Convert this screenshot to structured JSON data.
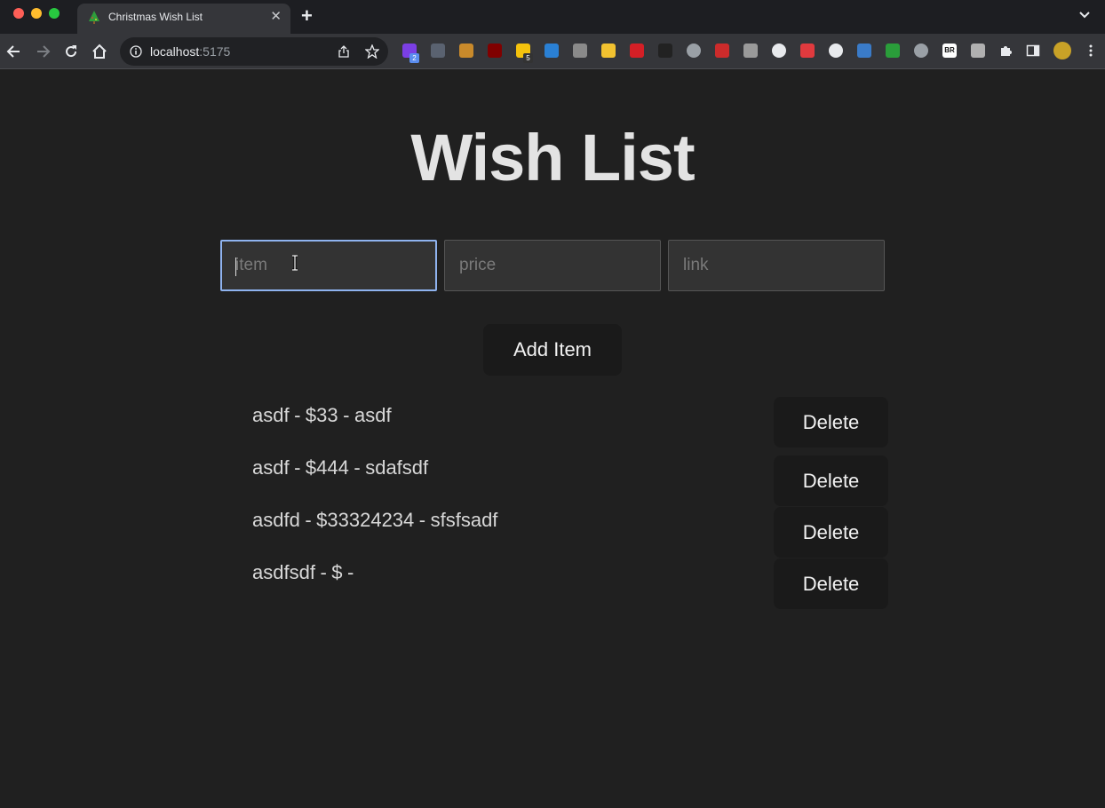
{
  "browser": {
    "tab_title": "Christmas Wish List",
    "tab_close": "✕",
    "new_tab": "+",
    "url_host": "localhost",
    "url_port": ":5175",
    "extensions": [
      {
        "icon": "ext-b-icon",
        "color": "#7b3fe4",
        "badge": "2"
      },
      {
        "icon": "ext-css-icon",
        "color": "#5a6270"
      },
      {
        "icon": "ext-box-icon",
        "color": "#c98a2b"
      },
      {
        "icon": "ublock-icon",
        "color": "#800000"
      },
      {
        "icon": "ext-note-icon",
        "color": "#f4c20d",
        "badge": "5"
      },
      {
        "icon": "ext-diamond-icon",
        "color": "#2a80d4"
      },
      {
        "icon": "ext-h-icon",
        "color": "#8a8a8a"
      },
      {
        "icon": "ext-circle-icon",
        "color": "#f2c230"
      },
      {
        "icon": "ext-red-icon",
        "color": "#d41f26"
      },
      {
        "icon": "ext-glasses-icon",
        "color": "#222222"
      },
      {
        "icon": "ext-check-icon",
        "color": "#9aa0a6"
      },
      {
        "icon": "ext-yt-icon",
        "color": "#cc2b2b"
      },
      {
        "icon": "ext-window-icon",
        "color": "#9a9a9a"
      },
      {
        "icon": "ext-move-icon",
        "color": "#e8eaed"
      },
      {
        "icon": "ext-dice-icon",
        "color": "#e03a3e"
      },
      {
        "icon": "ext-clock-icon",
        "color": "#e8eaed"
      },
      {
        "icon": "ext-grid-icon",
        "color": "#3a7bc8"
      },
      {
        "icon": "ext-shield-icon",
        "color": "#2a9d3a"
      },
      {
        "icon": "ext-down-icon",
        "color": "#9aa0a6"
      },
      {
        "icon": "ext-br-icon",
        "color": "#ffffff",
        "text": "BR"
      },
      {
        "icon": "ext-s-icon",
        "color": "#b0b0b0"
      },
      {
        "icon": "extensions-puzzle-icon",
        "color": "#e8eaed"
      },
      {
        "icon": "side-panel-icon",
        "color": "#e8eaed"
      },
      {
        "icon": "profile-avatar-icon",
        "color": "#c9a227"
      },
      {
        "icon": "menu-kebab-icon",
        "color": "#e8eaed"
      }
    ]
  },
  "app": {
    "title": "Wish List",
    "inputs": {
      "item_placeholder": "item",
      "price_placeholder": "price",
      "link_placeholder": "link"
    },
    "add_button": "Add Item",
    "delete_label": "Delete",
    "items": [
      {
        "name": "asdf",
        "price": "$33",
        "link": "asdf"
      },
      {
        "name": "asdf",
        "price": "$444",
        "link": "sdafsdf"
      },
      {
        "name": "asdfd",
        "price": "$33324234",
        "link": "sfsfsadf"
      },
      {
        "name": "asdfsdf",
        "price": "$",
        "link": ""
      }
    ]
  },
  "colors": {
    "page_bg": "#202020",
    "button_bg": "#1a1a1a",
    "focus_ring": "#8fb3ef"
  }
}
